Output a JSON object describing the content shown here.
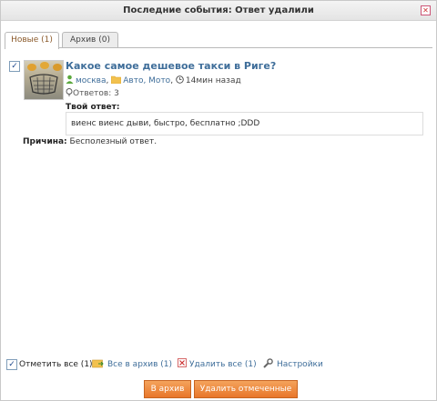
{
  "window": {
    "title": "Последние события: Ответ удалили"
  },
  "tabs": [
    {
      "label": "Новые (1)",
      "active": true
    },
    {
      "label": "Архив (0)",
      "active": false
    }
  ],
  "event": {
    "checked": true,
    "question_title": "Какое самое дешевое такси в Риге?",
    "author": "москва",
    "category": "Авто, Мото",
    "time": "14мин назад",
    "answers": "Ответов: 3",
    "your_answer_label": "Твой ответ:",
    "your_answer_text": "виенс виенс дыви, быстро, бесплатно ;DDD",
    "reason_label": "Причина:",
    "reason_text": "Бесполезный ответ."
  },
  "footer": {
    "select_all_checked": true,
    "select_all_label": "Отметить все (1)",
    "archive_all_label": "Все в архив (1)",
    "delete_all_label": "Удалить все (1)",
    "settings_label": "Настройки"
  },
  "buttons": {
    "to_archive": "В архив",
    "delete_selected": "Удалить отмеченные"
  },
  "colors": {
    "link": "#3f6e9a",
    "button": "#e8762a",
    "active_tab_text": "#8b5a2b"
  }
}
